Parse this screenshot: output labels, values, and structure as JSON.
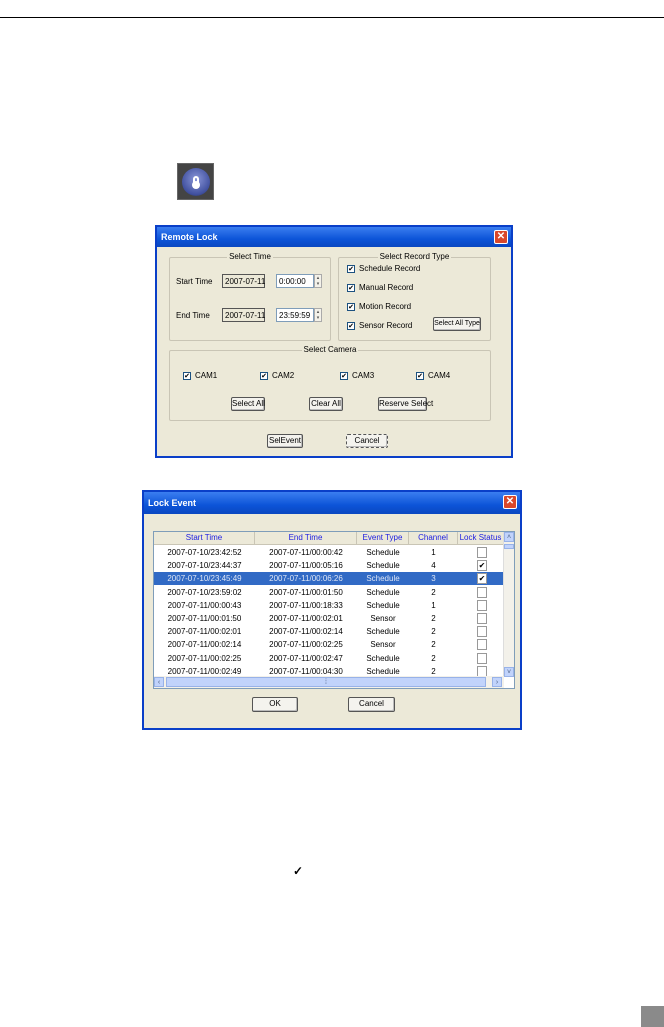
{
  "remote_lock": {
    "title": "Remote Lock",
    "select_time": {
      "legend": "Select Time",
      "start_label": "Start Time",
      "start_date": "2007-07-11",
      "start_time": "0:00:00",
      "end_label": "End Time",
      "end_date": "2007-07-11",
      "end_time": "23:59:59"
    },
    "record_type": {
      "legend": "Select Record Type",
      "items": [
        {
          "label": "Schedule Record",
          "checked": true
        },
        {
          "label": "Manual Record",
          "checked": true
        },
        {
          "label": "Motion Record",
          "checked": true
        },
        {
          "label": "Sensor Record",
          "checked": true
        }
      ],
      "select_all_label": "Select All Type"
    },
    "camera": {
      "legend": "Select Camera",
      "items": [
        {
          "label": "CAM1",
          "checked": true
        },
        {
          "label": "CAM2",
          "checked": true
        },
        {
          "label": "CAM3",
          "checked": true
        },
        {
          "label": "CAM4",
          "checked": true
        }
      ],
      "select_all": "Select All",
      "clear_all": "Clear All",
      "reverse": "Reserve Select"
    },
    "sel_event": "SelEvent",
    "cancel": "Cancel",
    "check_glyph": "✔"
  },
  "lock_event": {
    "title": "Lock Event",
    "columns": [
      "Start Time",
      "End Time",
      "Event Type",
      "Channel",
      "Lock Status"
    ],
    "rows": [
      {
        "start": "2007-07-10/23:42:52",
        "end": "2007-07-11/00:00:42",
        "type": "Schedule",
        "channel": "1",
        "locked": false
      },
      {
        "start": "2007-07-10/23:44:37",
        "end": "2007-07-11/00:05:16",
        "type": "Schedule",
        "channel": "4",
        "locked": true
      },
      {
        "start": "2007-07-10/23:45:49",
        "end": "2007-07-11/00:06:26",
        "type": "Schedule",
        "channel": "3",
        "locked": true,
        "selected": true
      },
      {
        "start": "2007-07-10/23:59:02",
        "end": "2007-07-11/00:01:50",
        "type": "Schedule",
        "channel": "2",
        "locked": false
      },
      {
        "start": "2007-07-11/00:00:43",
        "end": "2007-07-11/00:18:33",
        "type": "Schedule",
        "channel": "1",
        "locked": false
      },
      {
        "start": "2007-07-11/00:01:50",
        "end": "2007-07-11/00:02:01",
        "type": "Sensor",
        "channel": "2",
        "locked": false
      },
      {
        "start": "2007-07-11/00:02:01",
        "end": "2007-07-11/00:02:14",
        "type": "Schedule",
        "channel": "2",
        "locked": false
      },
      {
        "start": "2007-07-11/00:02:14",
        "end": "2007-07-11/00:02:25",
        "type": "Sensor",
        "channel": "2",
        "locked": false
      },
      {
        "start": "2007-07-11/00:02:25",
        "end": "2007-07-11/00:02:47",
        "type": "Schedule",
        "channel": "2",
        "locked": false
      },
      {
        "start": "2007-07-11/00:02:49",
        "end": "2007-07-11/00:04:30",
        "type": "Schedule",
        "channel": "2",
        "locked": false
      }
    ],
    "ok": "OK",
    "cancel": "Cancel",
    "check_glyph": "✔"
  },
  "page": {
    "checkmark": "✓"
  }
}
